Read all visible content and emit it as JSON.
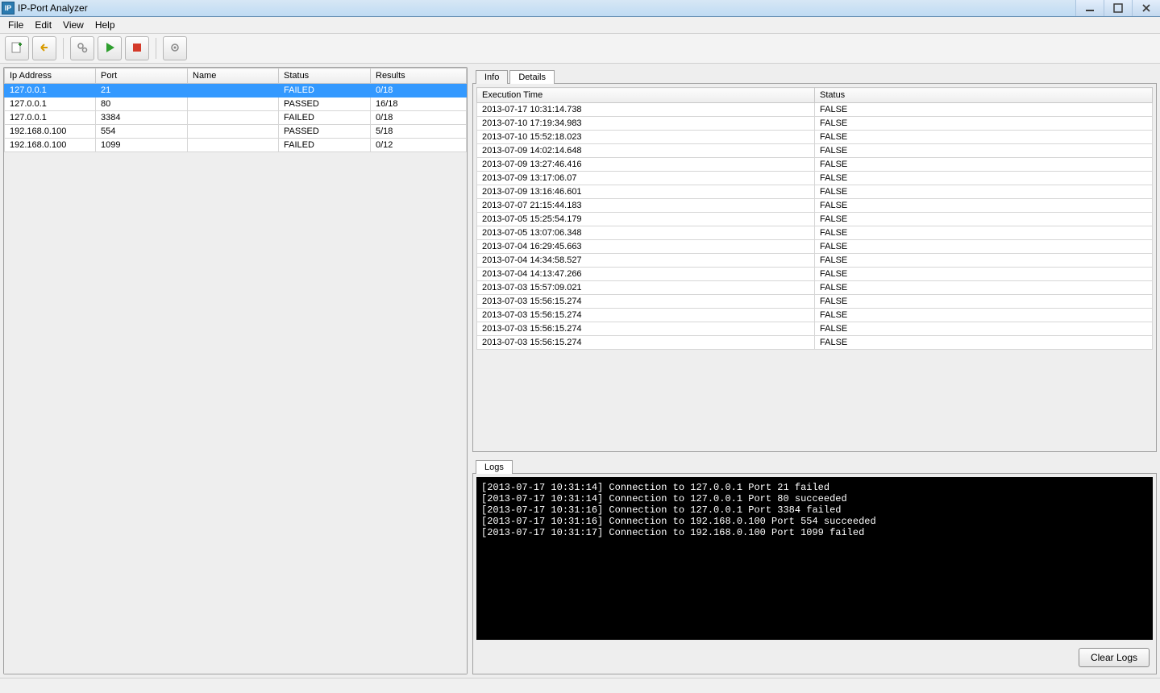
{
  "app": {
    "title": "IP-Port Analyzer"
  },
  "menu": {
    "file": "File",
    "edit": "Edit",
    "view": "View",
    "help": "Help"
  },
  "left_table": {
    "headers": {
      "ip": "Ip Address",
      "port": "Port",
      "name": "Name",
      "status": "Status",
      "results": "Results"
    },
    "rows": [
      {
        "ip": "127.0.0.1",
        "port": "21",
        "name": "",
        "status": "FAILED",
        "results": "0/18",
        "selected": true
      },
      {
        "ip": "127.0.0.1",
        "port": "80",
        "name": "",
        "status": "PASSED",
        "results": "16/18",
        "selected": false
      },
      {
        "ip": "127.0.0.1",
        "port": "3384",
        "name": "",
        "status": "FAILED",
        "results": "0/18",
        "selected": false
      },
      {
        "ip": "192.168.0.100",
        "port": "554",
        "name": "",
        "status": "PASSED",
        "results": "5/18",
        "selected": false
      },
      {
        "ip": "192.168.0.100",
        "port": "1099",
        "name": "",
        "status": "FAILED",
        "results": "0/12",
        "selected": false
      }
    ]
  },
  "tabs_top": {
    "info": "Info",
    "details": "Details"
  },
  "details_table": {
    "headers": {
      "time": "Execution Time",
      "status": "Status"
    },
    "rows": [
      {
        "time": "2013-07-17 10:31:14.738",
        "status": "FALSE"
      },
      {
        "time": "2013-07-10 17:19:34.983",
        "status": "FALSE"
      },
      {
        "time": "2013-07-10 15:52:18.023",
        "status": "FALSE"
      },
      {
        "time": "2013-07-09 14:02:14.648",
        "status": "FALSE"
      },
      {
        "time": "2013-07-09 13:27:46.416",
        "status": "FALSE"
      },
      {
        "time": "2013-07-09 13:17:06.07",
        "status": "FALSE"
      },
      {
        "time": "2013-07-09 13:16:46.601",
        "status": "FALSE"
      },
      {
        "time": "2013-07-07 21:15:44.183",
        "status": "FALSE"
      },
      {
        "time": "2013-07-05 15:25:54.179",
        "status": "FALSE"
      },
      {
        "time": "2013-07-05 13:07:06.348",
        "status": "FALSE"
      },
      {
        "time": "2013-07-04 16:29:45.663",
        "status": "FALSE"
      },
      {
        "time": "2013-07-04 14:34:58.527",
        "status": "FALSE"
      },
      {
        "time": "2013-07-04 14:13:47.266",
        "status": "FALSE"
      },
      {
        "time": "2013-07-03 15:57:09.021",
        "status": "FALSE"
      },
      {
        "time": "2013-07-03 15:56:15.274",
        "status": "FALSE"
      },
      {
        "time": "2013-07-03 15:56:15.274",
        "status": "FALSE"
      },
      {
        "time": "2013-07-03 15:56:15.274",
        "status": "FALSE"
      },
      {
        "time": "2013-07-03 15:56:15.274",
        "status": "FALSE"
      }
    ]
  },
  "tabs_logs": {
    "logs": "Logs"
  },
  "logs": {
    "lines": [
      "[2013-07-17 10:31:14] Connection to 127.0.0.1 Port 21 failed",
      "[2013-07-17 10:31:14] Connection to 127.0.0.1 Port 80 succeeded",
      "[2013-07-17 10:31:16] Connection to 127.0.0.1 Port 3384 failed",
      "[2013-07-17 10:31:16] Connection to 192.168.0.100 Port 554 succeeded",
      "[2013-07-17 10:31:17] Connection to 192.168.0.100 Port 1099 failed"
    ],
    "clear_label": "Clear Logs"
  }
}
